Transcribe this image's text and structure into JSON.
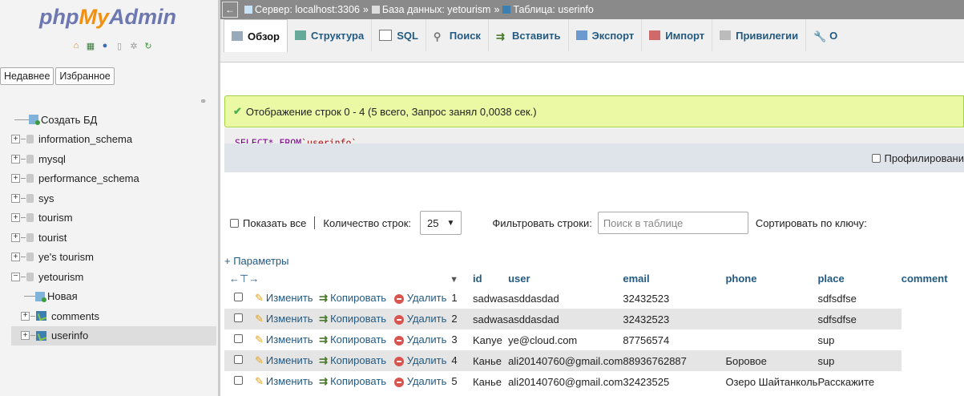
{
  "logo": {
    "php": "php",
    "my": "My",
    "admin": "Admin"
  },
  "sidebar": {
    "tabs": [
      "Недавнее",
      "Избранное"
    ],
    "tree": [
      {
        "label": "Создать БД",
        "kind": "new"
      },
      {
        "label": "information_schema",
        "kind": "db"
      },
      {
        "label": "mysql",
        "kind": "db"
      },
      {
        "label": "performance_schema",
        "kind": "db"
      },
      {
        "label": "sys",
        "kind": "db"
      },
      {
        "label": "tourism",
        "kind": "db"
      },
      {
        "label": "tourist",
        "kind": "db"
      },
      {
        "label": "ye's tourism",
        "kind": "db"
      },
      {
        "label": "yetourism",
        "kind": "db-open"
      },
      {
        "label": "Новая",
        "kind": "new-child"
      },
      {
        "label": "comments",
        "kind": "table"
      },
      {
        "label": "userinfo",
        "kind": "table-selected"
      }
    ]
  },
  "breadcrumb": {
    "server": "Сервер: localhost:3306",
    "sep": "»",
    "database": "База данных: yetourism",
    "table": "Таблица: userinfo"
  },
  "tabs": [
    "Обзор",
    "Структура",
    "SQL",
    "Поиск",
    "Вставить",
    "Экспорт",
    "Импорт",
    "Привилегии",
    "О"
  ],
  "notice": "Отображение строк 0 - 4 (5 всего, Запрос занял 0,0038 сек.)",
  "sql": {
    "select": "SELECT",
    "rest": " * FROM ",
    "table": "`userinfo`"
  },
  "profiling": "Профилировани",
  "controls": {
    "show_all": "Показать все",
    "rows_label": "Количество строк:",
    "rows_value": "25",
    "filter_label": "Фильтровать строки:",
    "filter_placeholder": "Поиск в таблице",
    "sort_label": "Сортировать по ключу:"
  },
  "params": "+ Параметры",
  "columns": [
    "id",
    "user",
    "email",
    "phone",
    "place",
    "comment"
  ],
  "actions": {
    "edit": "Изменить",
    "copy": "Копировать",
    "delete": "Удалить"
  },
  "rows": [
    {
      "id": "1",
      "user": "sadwas",
      "email": "asddasdad",
      "phone": "32432523",
      "place": "",
      "comment": "sdfsdfse"
    },
    {
      "id": "2",
      "user": "sadwas",
      "email": "asddasdad",
      "phone": "32432523",
      "place": "",
      "comment": "sdfsdfse"
    },
    {
      "id": "3",
      "user": "Kanye",
      "email": "ye@cloud.com",
      "phone": "87756574",
      "place": "",
      "comment": "sup"
    },
    {
      "id": "4",
      "user": "Канье",
      "email": "ali20140760@gmail.com",
      "phone": "88936762887",
      "place": "Боровое",
      "comment": "sup"
    },
    {
      "id": "5",
      "user": "Канье",
      "email": "ali20140760@gmail.com",
      "phone": "32423525",
      "place": "Озеро Шайтанколь",
      "comment": "Расскажите"
    }
  ]
}
